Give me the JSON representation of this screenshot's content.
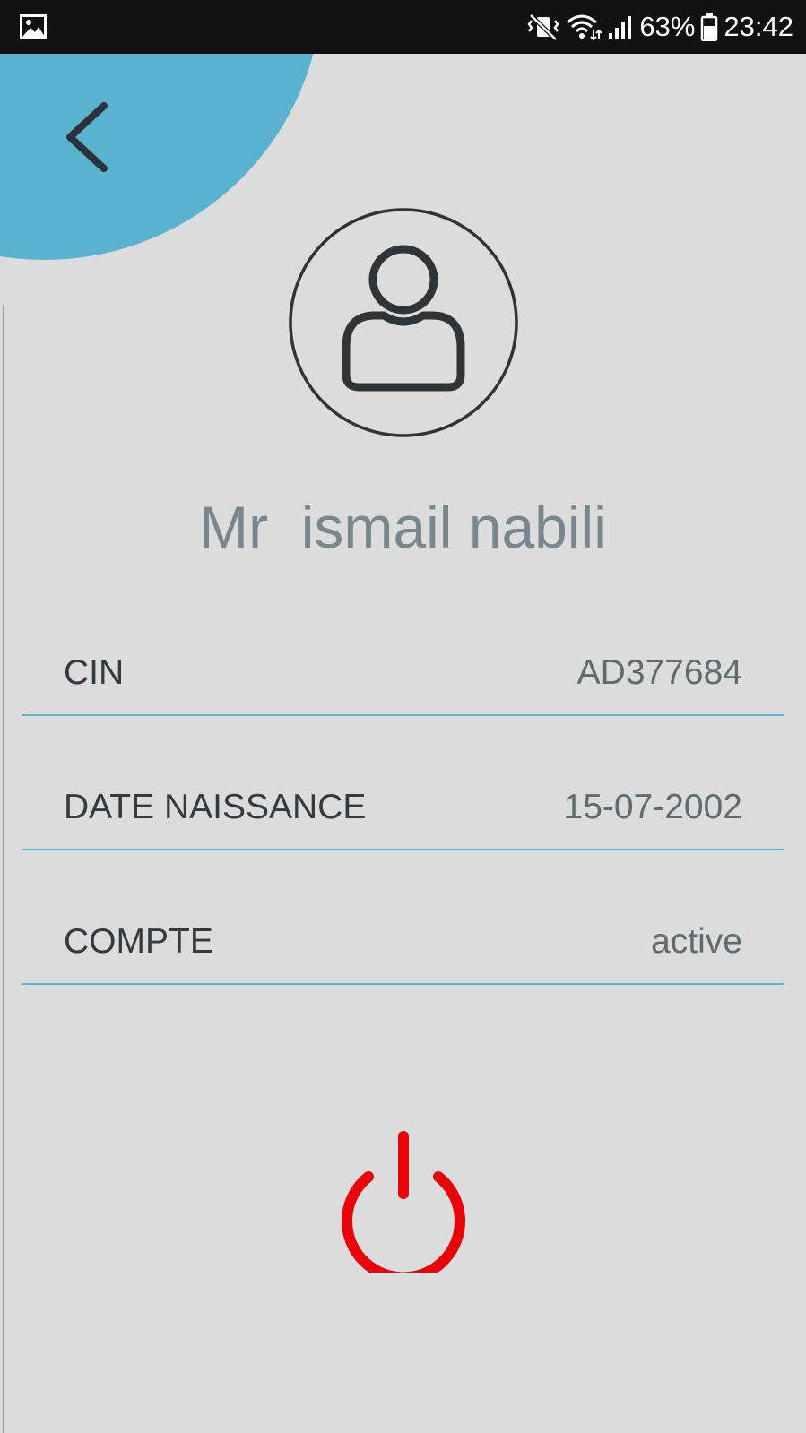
{
  "status_bar": {
    "battery": "63%",
    "time": "23:42"
  },
  "profile": {
    "name": "Mr  ismail nabili"
  },
  "fields": [
    {
      "label": "CIN",
      "value": "AD377684"
    },
    {
      "label": "DATE NAISSANCE",
      "value": "15-07-2002"
    },
    {
      "label": "COMPTE",
      "value": "active"
    }
  ],
  "colors": {
    "accent": "#58b2d0",
    "logout": "#e8050a",
    "background": "#dcdcdc"
  },
  "icons": {
    "back": "chevron-left-icon",
    "avatar": "user-circle-icon",
    "logout": "power-icon"
  }
}
